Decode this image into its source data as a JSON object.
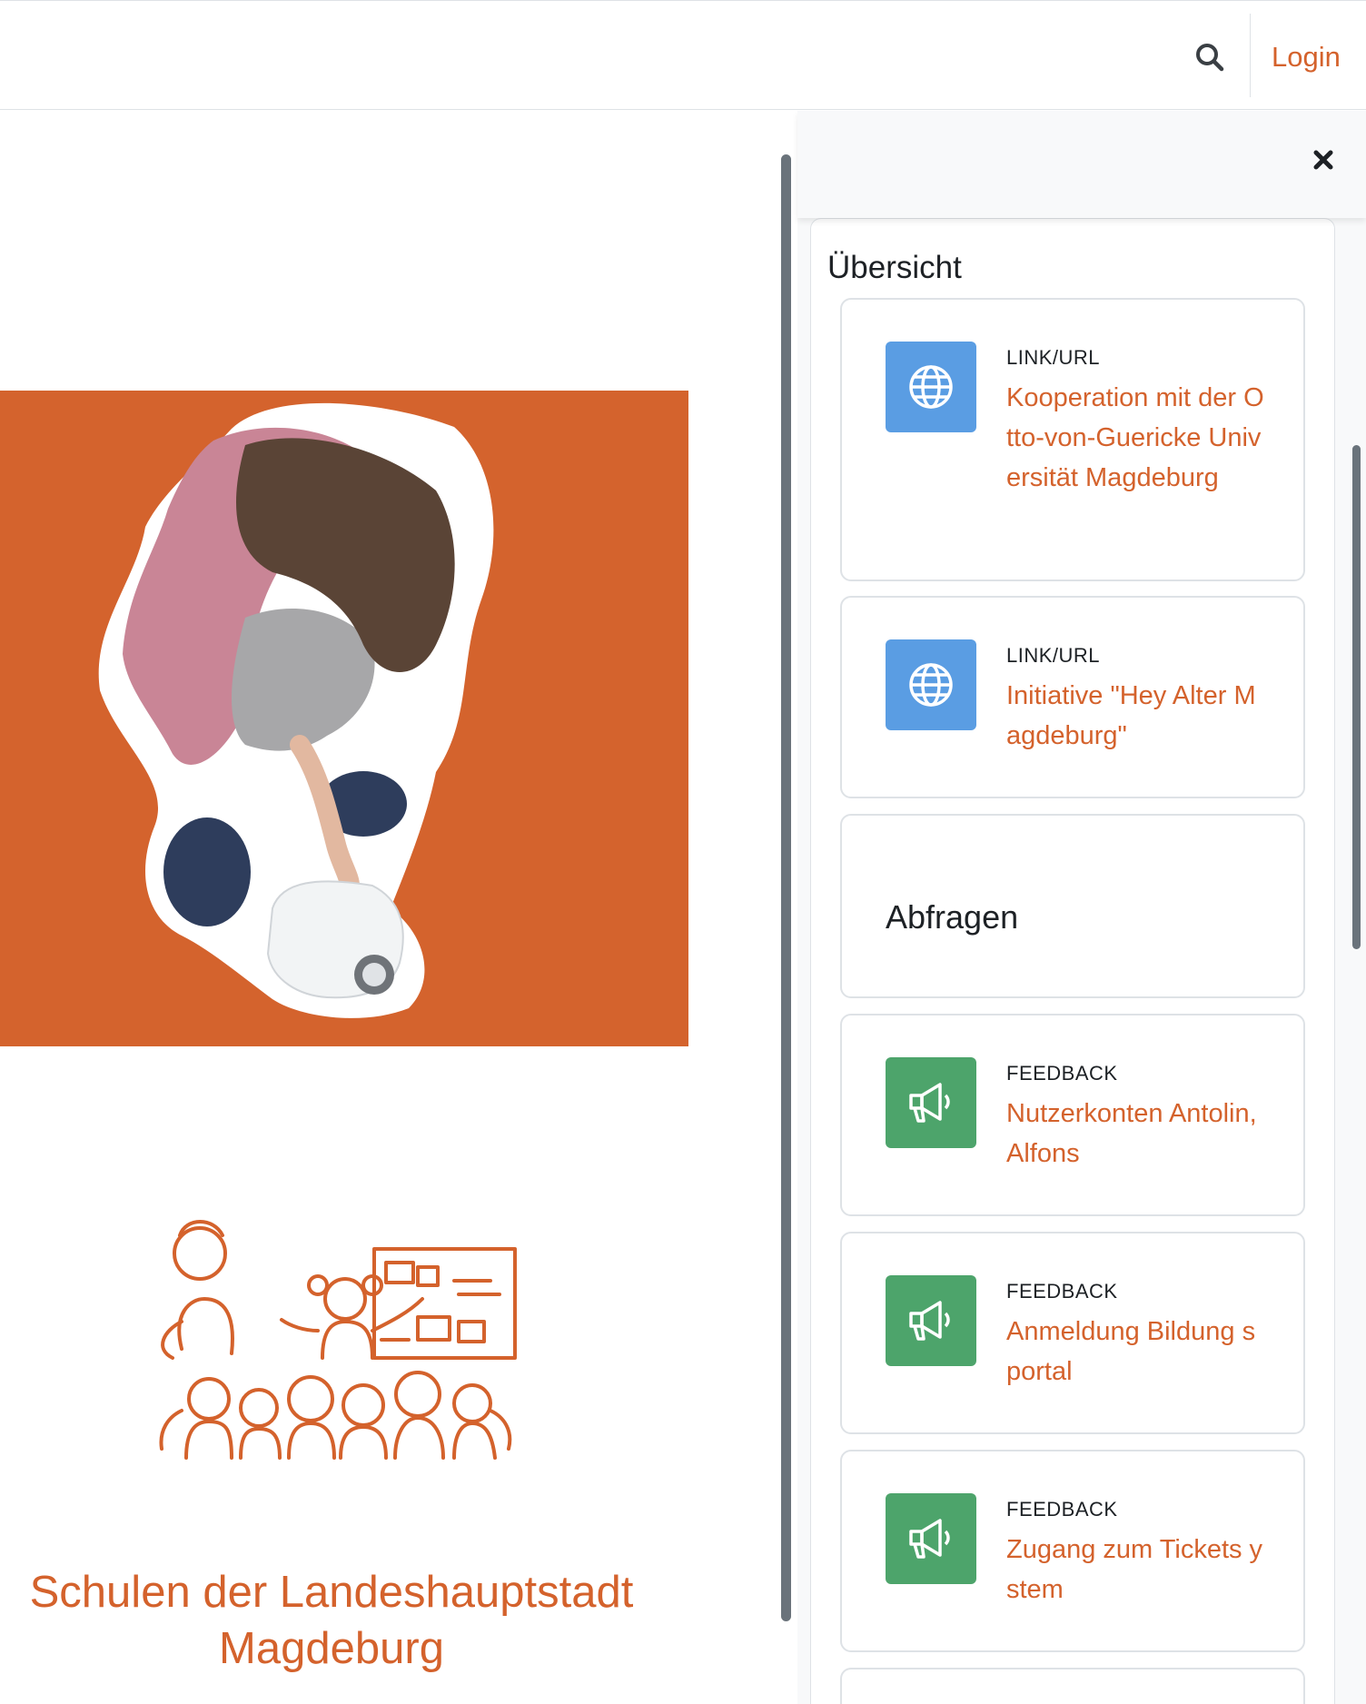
{
  "navbar": {
    "search_icon": "search-icon",
    "login_label": "Login"
  },
  "main": {
    "school_title_line1": "Schulen der Landeshauptstadt",
    "school_title_line2": "Magdeburg",
    "hero_color": "#d4632d",
    "accent_color": "#d4622c"
  },
  "drawer": {
    "close_icon": "close-icon",
    "heading": "Übersicht",
    "items": [
      {
        "kind": "activity",
        "type": "LINK/URL",
        "name": "Kooperation mit der Otto-von-Guericke Universität Magdeburg",
        "icon": "globe-icon",
        "icon_color": "#5a9de3"
      },
      {
        "kind": "activity",
        "type": "LINK/URL",
        "name": "Initiative \"Hey Alter Magdeburg\"",
        "icon": "globe-icon",
        "icon_color": "#5a9de3"
      },
      {
        "kind": "section",
        "name": "Abfragen"
      },
      {
        "kind": "activity",
        "type": "FEEDBACK",
        "name": "Nutzerkonten Antolin, Alfons",
        "icon": "megaphone-icon",
        "icon_color": "#4da46b"
      },
      {
        "kind": "activity",
        "type": "FEEDBACK",
        "name": "Anmeldung Bildung sportal",
        "icon": "megaphone-icon",
        "icon_color": "#4da46b"
      },
      {
        "kind": "activity",
        "type": "FEEDBACK",
        "name": "Zugang zum Tickets ystem",
        "icon": "megaphone-icon",
        "icon_color": "#4da46b"
      }
    ]
  }
}
